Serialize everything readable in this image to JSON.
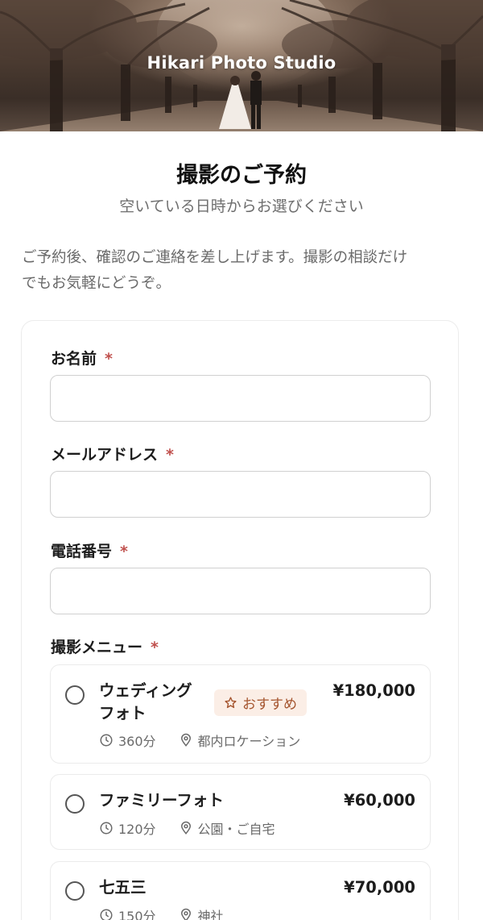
{
  "hero": {
    "title": "Hikari Photo Studio"
  },
  "header": {
    "title": "撮影のご予約",
    "subtitle": "空いている日時からお選びください"
  },
  "intro": {
    "line1": "ご予約後、確認のご連絡を差し上げます。撮影の相談だけ",
    "line2": "でもお気軽にどうぞ。"
  },
  "form": {
    "name_label": "お名前",
    "email_label": "メールアドレス",
    "phone_label": "電話番号",
    "menu_label": "撮影メニュー",
    "required_mark": "*",
    "menu_options": [
      {
        "name_line1": "ウェディング",
        "name_line2": "フォト",
        "badge": "おすすめ",
        "price": "¥180,000",
        "duration": "360分",
        "location": "都内ロケーション",
        "selected": false
      },
      {
        "name_line1": "ファミリーフォト",
        "price": "¥60,000",
        "duration": "120分",
        "location": "公園・ご自宅",
        "selected": false
      },
      {
        "name_line1": "七五三",
        "price": "¥70,000",
        "duration": "150分",
        "location": "神社",
        "selected": false
      }
    ]
  },
  "colors": {
    "required": "#c0504d",
    "badge_bg": "#fbeee6",
    "badge_text": "#a5552f"
  }
}
